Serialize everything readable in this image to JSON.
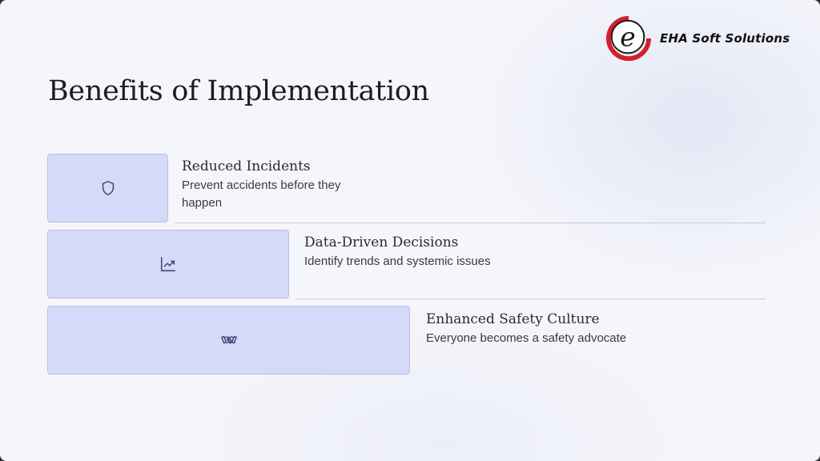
{
  "brand": {
    "name": "EHA Soft Solutions",
    "accent_red": "#d4202b",
    "logo_icon": "e-letter-logo-icon"
  },
  "slide": {
    "title": "Benefits of Implementation"
  },
  "benefits": [
    {
      "icon": "shield-icon",
      "title": "Reduced Incidents",
      "description": "Prevent accidents before they happen"
    },
    {
      "icon": "trend-chart-icon",
      "title": "Data-Driven Decisions",
      "description": "Identify trends and systemic issues"
    },
    {
      "icon": "handshake-icon",
      "title": "Enhanced Safety Culture",
      "description": "Everyone becomes a safety advocate"
    }
  ],
  "colors": {
    "background": "#f5f6fb",
    "card_fill": "#d4daf7",
    "card_border": "#b7bfe6",
    "title_text": "#1c1c22",
    "divider": "#c7cbe0"
  }
}
